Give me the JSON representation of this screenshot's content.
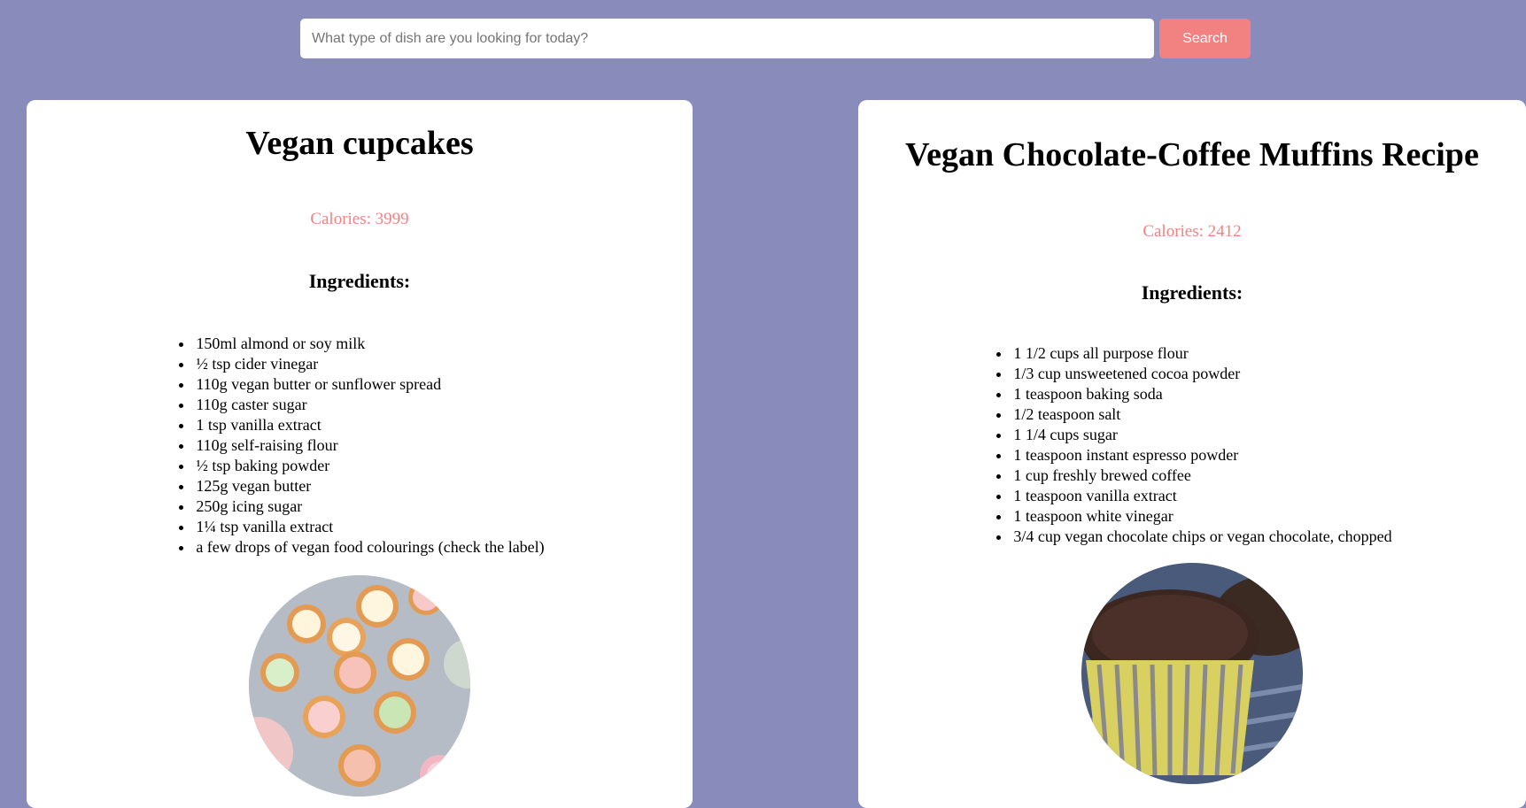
{
  "search": {
    "placeholder": "What type of dish are you looking for today?",
    "value": "",
    "button_label": "Search"
  },
  "colors": {
    "background": "#898bba",
    "accent": "#f28282",
    "card": "#ffffff"
  },
  "recipes": [
    {
      "title": "Vegan cupcakes",
      "calories": "Calories: 3999",
      "ingredients_heading": "Ingredients:",
      "ingredients": [
        "150ml almond or soy milk",
        "½ tsp cider vinegar",
        "110g vegan butter or sunflower spread",
        "110g caster sugar",
        "1 tsp vanilla extract",
        "110g self-raising flour",
        "½ tsp baking powder",
        "125g vegan butter",
        "250g icing sugar",
        "1¼ tsp vanilla extract",
        "a few drops of vegan food colourings (check the label)"
      ],
      "image": "cupcakes-photo"
    },
    {
      "title": "Vegan Chocolate-Coffee Muffins Recipe",
      "calories": "Calories: 2412",
      "ingredients_heading": "Ingredients:",
      "ingredients": [
        "1 1/2 cups all purpose flour",
        "1/3 cup unsweetened cocoa powder",
        "1 teaspoon baking soda",
        "1/2 teaspoon salt",
        "1 1/4 cups sugar",
        "1 teaspoon instant espresso powder",
        "1 cup freshly brewed coffee",
        "1 teaspoon vanilla extract",
        "1 teaspoon white vinegar",
        "3/4 cup vegan chocolate chips or vegan chocolate, chopped"
      ],
      "image": "muffin-photo"
    }
  ]
}
